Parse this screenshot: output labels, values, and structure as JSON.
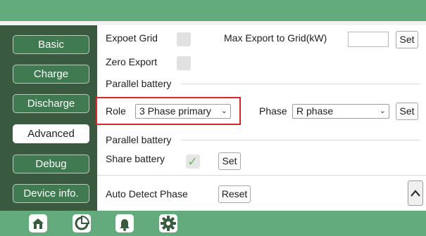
{
  "sidebar": {
    "items": [
      {
        "label": "Basic",
        "active": false
      },
      {
        "label": "Charge",
        "active": false
      },
      {
        "label": "Discharge",
        "active": false
      },
      {
        "label": "Advanced",
        "active": true
      },
      {
        "label": "Debug",
        "active": false
      },
      {
        "label": "Device info.",
        "active": false
      }
    ]
  },
  "export": {
    "expoet_grid_label": "Expoet Grid",
    "expoet_grid_checked": false,
    "max_export_label": "Max Export to Grid(kW)",
    "max_export_value": "",
    "set_label": "Set",
    "zero_export_label": "Zero Export",
    "zero_export_checked": false
  },
  "parallel": {
    "section_title": "Parallel battery",
    "role_label": "Role",
    "role_value": "3 Phase primary",
    "phase_label": "Phase",
    "phase_value": "R phase",
    "set_label": "Set"
  },
  "share": {
    "section_title": "Parallel battery",
    "share_label": "Share battery",
    "share_checked": true,
    "set_label": "Set"
  },
  "auto_detect": {
    "label": "Auto Detect Phase",
    "reset_label": "Reset"
  },
  "bottom_nav": {
    "icons": [
      "home-icon",
      "pie-chart-icon",
      "bell-icon",
      "gear-icon"
    ],
    "active": "gear-icon"
  },
  "colors": {
    "header_green": "#63ab7c",
    "sidebar_dark": "#3a5a40",
    "sidebar_button": "#3f7a51",
    "highlight_red": "#d8262f",
    "check_green": "#6cc05a"
  }
}
